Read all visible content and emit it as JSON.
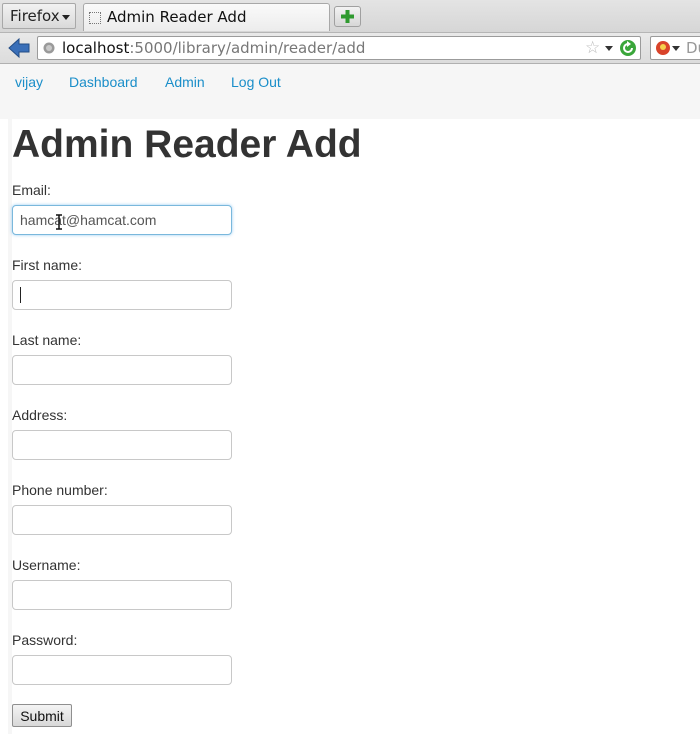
{
  "browser": {
    "menu_button": "Firefox",
    "tab_title": "Admin Reader Add",
    "url_host": "localhost",
    "url_rest": ":5000/library/admin/reader/add",
    "search_text": "Du"
  },
  "nav": {
    "user": "vijay",
    "dashboard": "Dashboard",
    "admin": "Admin",
    "logout": "Log Out"
  },
  "page": {
    "title": "Admin Reader Add"
  },
  "form": {
    "email_label": "Email:",
    "email_value": "hamcat@hamcat.com",
    "first_name_label": "First name:",
    "first_name_value": "",
    "last_name_label": "Last name:",
    "last_name_value": "",
    "address_label": "Address:",
    "address_value": "",
    "phone_label": "Phone number:",
    "phone_value": "",
    "username_label": "Username:",
    "username_value": "",
    "password_label": "Password:",
    "password_value": "",
    "submit_label": "Submit"
  },
  "colors": {
    "link": "#1a8ec9",
    "heading": "#333333",
    "focus_border": "#7ab8dc"
  }
}
